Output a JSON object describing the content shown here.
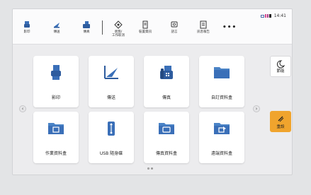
{
  "status_bar": {
    "time": "14:41"
  },
  "toolbar": {
    "items": [
      {
        "label": "影印"
      },
      {
        "label": "傳送"
      },
      {
        "label": "傳真"
      },
      {
        "label": "狀態/\n工作取消"
      },
      {
        "label": "裝置資訊"
      },
      {
        "label": "語言"
      },
      {
        "label": "訊息報告"
      }
    ],
    "more_label": "•••"
  },
  "tiles": [
    {
      "label": "影印",
      "icon": "copy-icon"
    },
    {
      "label": "傳送",
      "icon": "send-icon"
    },
    {
      "label": "傳真",
      "icon": "fax-icon"
    },
    {
      "label": "自訂資料盒",
      "icon": "folder-icon"
    },
    {
      "label": "作業資料盒",
      "icon": "job-box-icon"
    },
    {
      "label": "USB 隨身碟",
      "icon": "usb-icon"
    },
    {
      "label": "傳真資料盒",
      "icon": "fax-box-icon"
    },
    {
      "label": "遠端資料盒",
      "icon": "remote-box-icon"
    }
  ],
  "side": {
    "energy_label": "節能",
    "reset_label": "重設"
  },
  "pager": {
    "left": "‹",
    "right": "›"
  },
  "colors": {
    "accent_blue": "#3a6fb8",
    "reset_orange": "#f0a42d",
    "folder_blue": "#4a83c6"
  }
}
